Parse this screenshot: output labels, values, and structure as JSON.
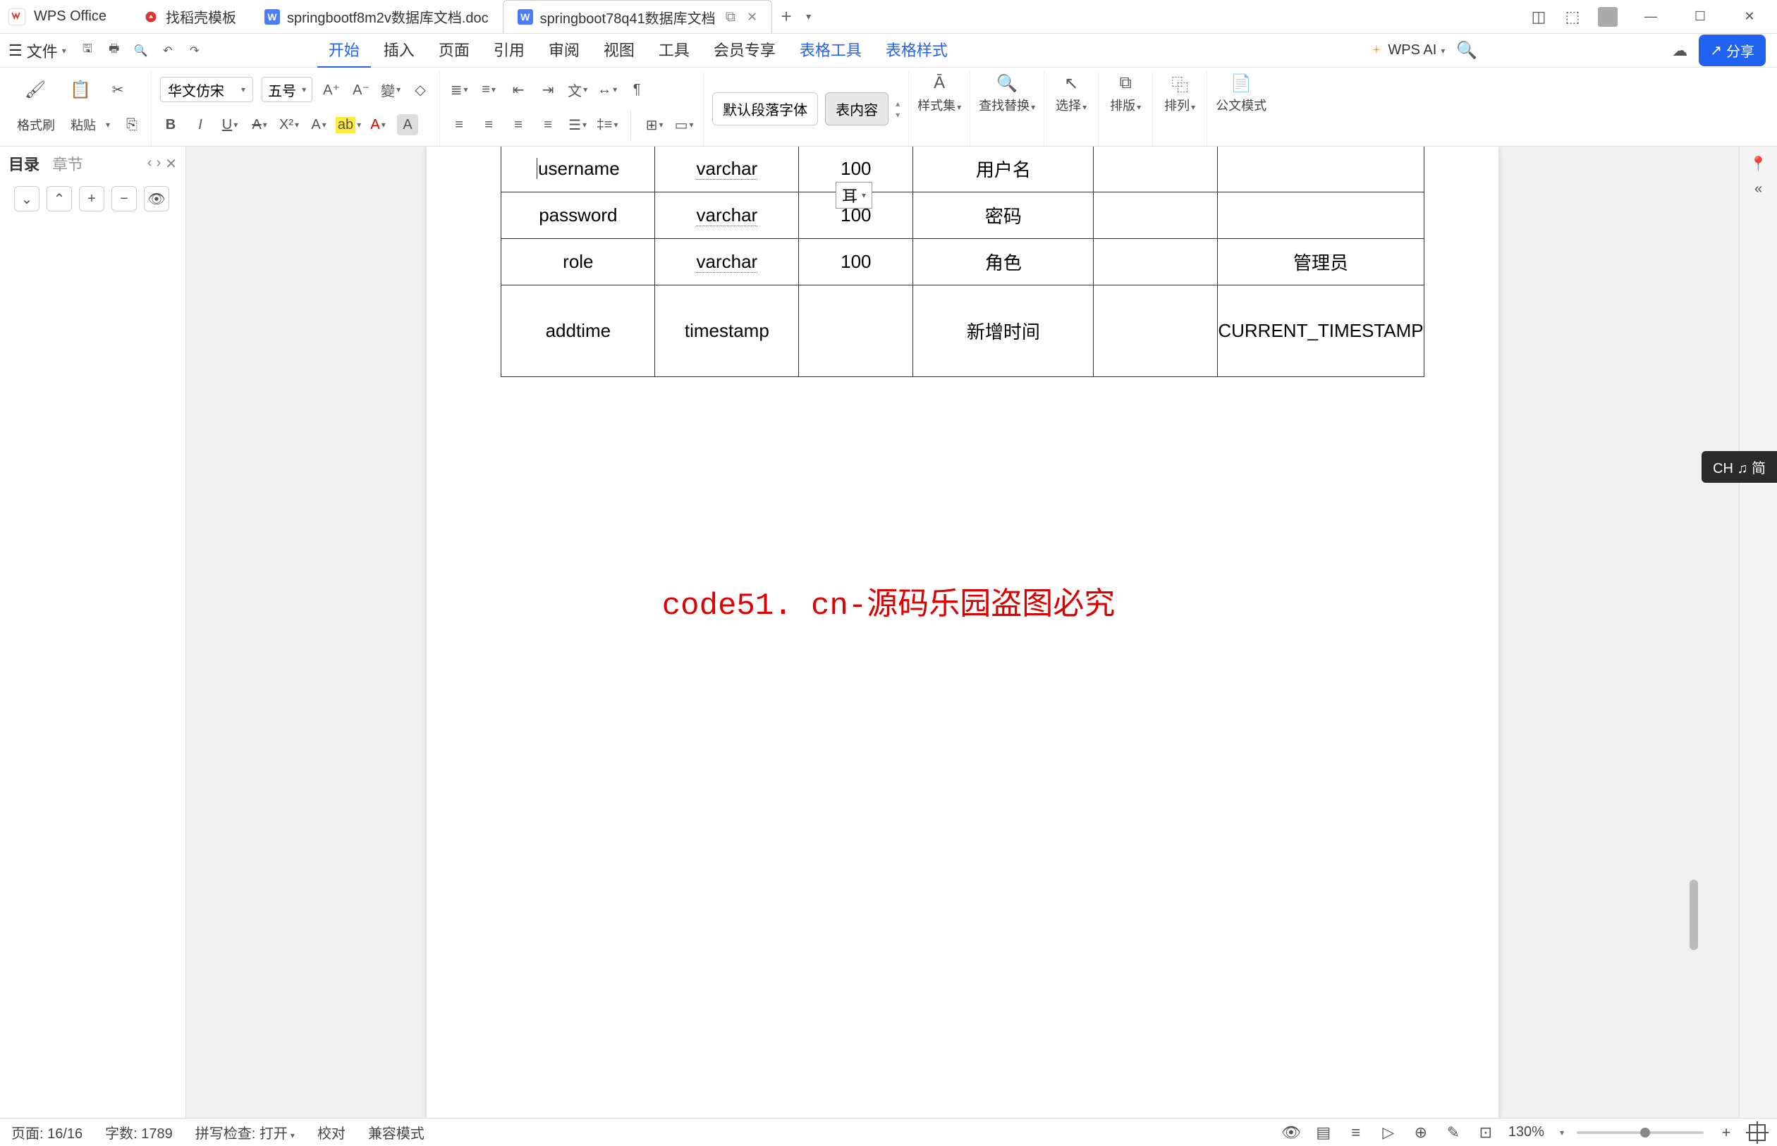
{
  "titlebar": {
    "app": "WPS Office",
    "tabs": [
      {
        "label": "找稻壳模板",
        "icon": "d"
      },
      {
        "label": "springbootf8m2v数据库文档.doc",
        "icon": "w"
      },
      {
        "label": "springboot78q41数据库文档",
        "icon": "w",
        "active": true
      }
    ]
  },
  "menubar": {
    "file": "文件",
    "items": [
      "开始",
      "插入",
      "页面",
      "引用",
      "审阅",
      "视图",
      "工具",
      "会员专享",
      "表格工具",
      "表格样式"
    ],
    "active": "开始",
    "tableItems": [
      "表格工具",
      "表格样式"
    ],
    "ai": "WPS AI",
    "share": "分享"
  },
  "ribbon": {
    "formatBrush": "格式刷",
    "paste": "粘贴",
    "fontFamily": "华文仿宋",
    "fontSize": "五号",
    "paraDefault": "默认段落字体",
    "tableContent": "表内容",
    "styleSet": "样式集",
    "findReplace": "查找替换",
    "select": "选择",
    "layout": "排版",
    "arrange": "排列",
    "docMode": "公文模式"
  },
  "sidebar": {
    "tab1": "目录",
    "tab2": "章节"
  },
  "table": {
    "combo": "耳",
    "rows": [
      {
        "c1": "username",
        "c2": "varchar",
        "c3": "100",
        "c4": "用户名",
        "c5": "",
        "c6": ""
      },
      {
        "c1": "password",
        "c2": "varchar",
        "c3": "100",
        "c4": "密码",
        "c5": "",
        "c6": ""
      },
      {
        "c1": "role",
        "c2": "varchar",
        "c3": "100",
        "c4": "角色",
        "c5": "",
        "c6": "管理员"
      },
      {
        "c1": "addtime",
        "c2": "timestamp",
        "c3": "",
        "c4": "新增时间",
        "c5": "",
        "c6": "CURRENT_TIMESTAMP"
      }
    ]
  },
  "watermark_text": "code51.cn",
  "big_watermark": "code51. cn-源码乐园盗图必究",
  "ime": "CH ♫ 简",
  "statusbar": {
    "page": "页面: 16/16",
    "words": "字数: 1789",
    "spell": "拼写检查: 打开",
    "proof": "校对",
    "compat": "兼容模式",
    "zoom": "130%"
  }
}
